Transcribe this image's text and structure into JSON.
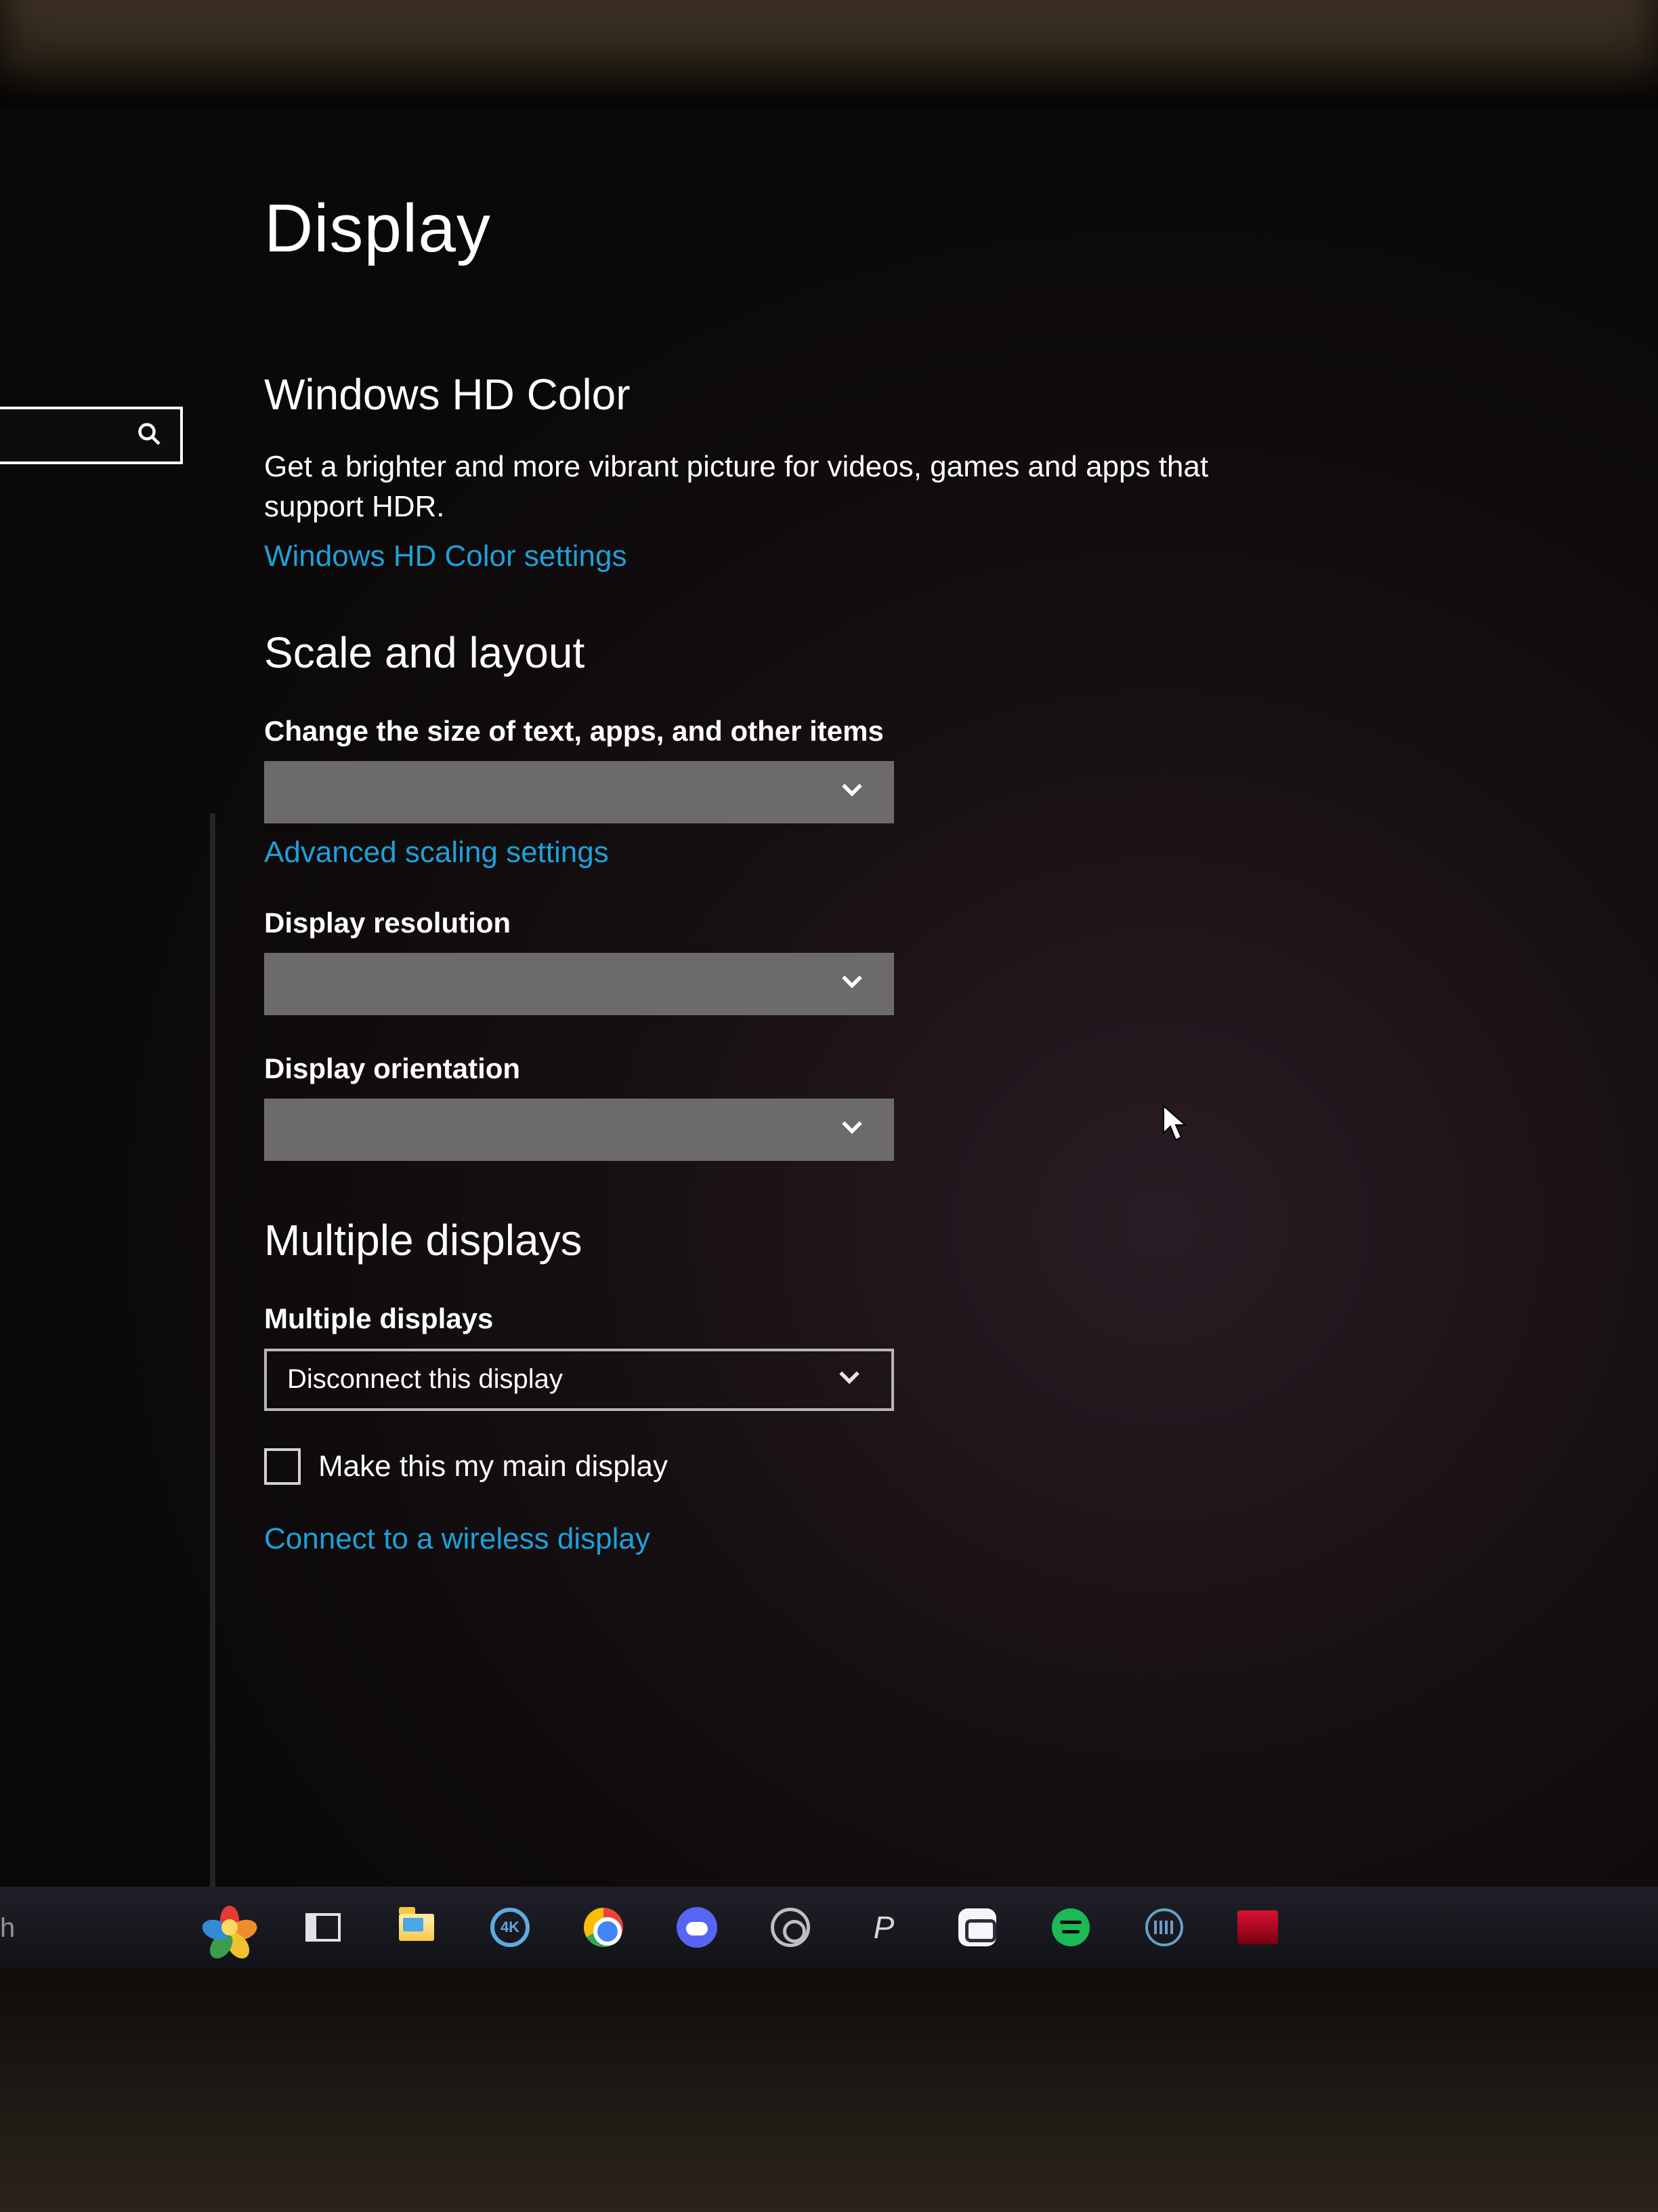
{
  "page": {
    "title": "Display"
  },
  "sidebar": {
    "search_placeholder": ""
  },
  "hdcolor": {
    "heading": "Windows HD Color",
    "desc": "Get a brighter and more vibrant picture for videos, games and apps that support HDR.",
    "link": "Windows HD Color settings"
  },
  "scale": {
    "heading": "Scale and layout",
    "size_label": "Change the size of text, apps, and other items",
    "size_value": "",
    "advanced_link": "Advanced scaling settings",
    "resolution_label": "Display resolution",
    "resolution_value": "",
    "orientation_label": "Display orientation",
    "orientation_value": ""
  },
  "multi": {
    "heading": "Multiple displays",
    "label": "Multiple displays",
    "value": "Disconnect this display",
    "checkbox_label": "Make this my main display",
    "wireless_link": "Connect to a wireless display"
  },
  "taskbar": {
    "search_hint": "h",
    "icons": {
      "flower": "photos-flower-icon",
      "taskview": "task-view-icon",
      "explorer": "file-explorer-icon",
      "fourk": "4K",
      "chrome": "chrome-icon",
      "discord": "discord-icon",
      "obs": "obs-icon",
      "p": "P",
      "streamlabs": "streamlabs-icon",
      "spotify": "spotify-icon",
      "onscreenkb": "on-screen-keyboard-icon",
      "redapp": "red-app-icon"
    }
  }
}
